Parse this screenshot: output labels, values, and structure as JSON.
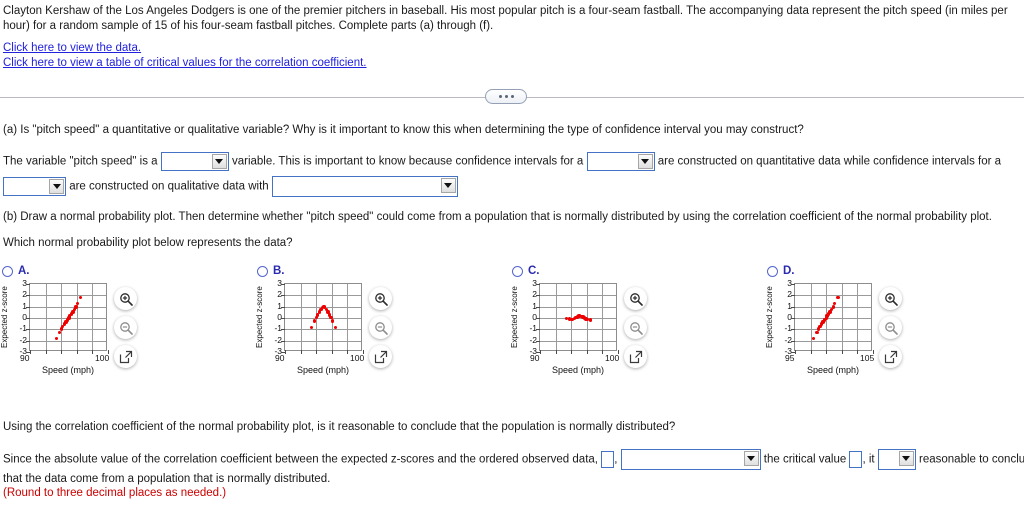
{
  "intro": {
    "paragraph": "Clayton Kershaw of the Los Angeles Dodgers is one of the premier pitchers in baseball. His most popular pitch is a four-seam fastball. The accompanying data represent the pitch speed (in miles per hour) for a random sample of 15 of his four-seam fastball pitches. Complete parts (a) through (f).",
    "link_data": "Click here to view the data.",
    "link_table": "Click here to view a table of critical values for the correlation coefficient."
  },
  "divider": {
    "dots_label": "..."
  },
  "part_a": {
    "question": "(a) Is \"pitch speed\" a quantitative or qualitative variable? Why is it important to know this when determining the type of confidence interval you may construct?",
    "answer_seg1": "The variable \"pitch speed\" is a",
    "answer_seg2": "variable. This is important to know because confidence intervals for a",
    "answer_seg3": "are constructed on quantitative data while confidence intervals for a",
    "answer_seg4": "are constructed on qualitative data with",
    "dropdown1_value": "",
    "dropdown2_value": "",
    "dropdown3_value": "",
    "dropdown4_value": ""
  },
  "part_b": {
    "question": "(b) Draw a normal probability plot. Then determine whether \"pitch speed\" could come from a population that is normally distributed by using the correlation coefficient of the normal probability plot.",
    "prompt": "Which normal probability plot below represents the data?",
    "options": [
      {
        "label": "A.",
        "selected": false
      },
      {
        "label": "B.",
        "selected": false
      },
      {
        "label": "C.",
        "selected": false
      },
      {
        "label": "D.",
        "selected": false
      }
    ],
    "icon_buttons": [
      {
        "name": "zoom-in-icon",
        "title": "Zoom In"
      },
      {
        "name": "zoom-out-icon",
        "title": "Zoom Out"
      },
      {
        "name": "expand-icon",
        "title": "View Larger"
      }
    ]
  },
  "chart_data": [
    {
      "type": "scatter",
      "option": "A",
      "title": "",
      "xlabel": "Speed (mph)",
      "ylabel": "Expected z-score",
      "xlim": [
        90,
        100
      ],
      "ylim": [
        -3,
        3
      ],
      "xticks": [
        90,
        100
      ],
      "yticks": [
        3,
        2,
        1,
        0,
        -1,
        -2,
        -3
      ],
      "grid": true,
      "x": [
        93.4,
        93.8,
        94.0,
        94.2,
        94.4,
        94.6,
        94.8,
        95.0,
        95.1,
        95.3,
        95.5,
        95.7,
        95.9,
        96.1,
        96.5
      ],
      "y": [
        -1.83,
        -1.28,
        -0.97,
        -0.73,
        -0.52,
        -0.34,
        -0.17,
        0.0,
        0.17,
        0.34,
        0.52,
        0.73,
        0.97,
        1.28,
        1.83
      ]
    },
    {
      "type": "scatter",
      "option": "B",
      "title": "",
      "xlabel": "Speed (mph)",
      "ylabel": "Expected z-score",
      "xlim": [
        90,
        100
      ],
      "ylim": [
        -3,
        3
      ],
      "xticks": [
        90,
        100
      ],
      "yticks": [
        3,
        2,
        1,
        0,
        -1,
        -2,
        -3
      ],
      "grid": true,
      "x": [
        93.4,
        93.8,
        94.0,
        94.2,
        94.4,
        94.6,
        94.8,
        95.0,
        95.1,
        95.3,
        95.5,
        95.7,
        95.9,
        96.1,
        96.5
      ],
      "y": [
        -0.83,
        -0.28,
        0.03,
        0.27,
        0.52,
        0.74,
        0.9,
        1.0,
        0.9,
        0.74,
        0.52,
        0.27,
        0.03,
        -0.28,
        -0.83
      ]
    },
    {
      "type": "scatter",
      "option": "C",
      "title": "",
      "xlabel": "Speed (mph)",
      "ylabel": "Expected z-score",
      "xlim": [
        90,
        100
      ],
      "ylim": [
        -3,
        3
      ],
      "xticks": [
        90,
        100
      ],
      "yticks": [
        3,
        2,
        1,
        0,
        -1,
        -2,
        -3
      ],
      "grid": true,
      "x": [
        93.4,
        93.8,
        94.0,
        94.2,
        94.4,
        94.6,
        94.8,
        95.0,
        95.1,
        95.3,
        95.5,
        95.7,
        95.9,
        96.1,
        96.5
      ],
      "y": [
        -0.04,
        -0.1,
        -0.14,
        -0.12,
        -0.06,
        0.02,
        0.1,
        0.16,
        0.18,
        0.14,
        0.08,
        0.0,
        -0.08,
        -0.14,
        -0.18
      ]
    },
    {
      "type": "scatter",
      "option": "D",
      "title": "",
      "xlabel": "Speed (mph)",
      "ylabel": "Expected z-score",
      "xlim": [
        95,
        105
      ],
      "ylim": [
        -3,
        3
      ],
      "xticks": [
        95,
        105
      ],
      "yticks": [
        3,
        2,
        1,
        0,
        -1,
        -2,
        -3
      ],
      "grid": true,
      "x": [
        97.4,
        97.8,
        98.0,
        98.2,
        98.4,
        98.6,
        98.8,
        99.0,
        99.1,
        99.3,
        99.5,
        99.7,
        99.9,
        100.1,
        100.5
      ],
      "y": [
        -1.83,
        -1.28,
        -0.97,
        -0.73,
        -0.52,
        -0.34,
        -0.17,
        0.0,
        0.17,
        0.34,
        0.52,
        0.73,
        0.97,
        1.28,
        1.83
      ]
    }
  ],
  "part_b_followup": {
    "question": "Using the correlation coefficient of the normal probability plot, is it reasonable to conclude that the population is normally distributed?",
    "seg1": "Since the absolute value of the correlation coefficient between the expected z-scores and the ordered observed data,",
    "comma1": ",",
    "seg2": "the critical value",
    "comma2": ", it",
    "seg3": "reasonable to conclude",
    "seg4": "that the data come from a population that is normally distributed.",
    "round_note": "(Round to three decimal places as needed.)",
    "textbox1_value": "",
    "dropdown1_value": "",
    "textbox2_value": "",
    "dropdown2_value": ""
  },
  "colors": {
    "link": "#2222dd",
    "option_label": "#2a2ab0",
    "point": "#ee0000",
    "field_border": "#4472c4",
    "red_note": "#cc0000"
  }
}
